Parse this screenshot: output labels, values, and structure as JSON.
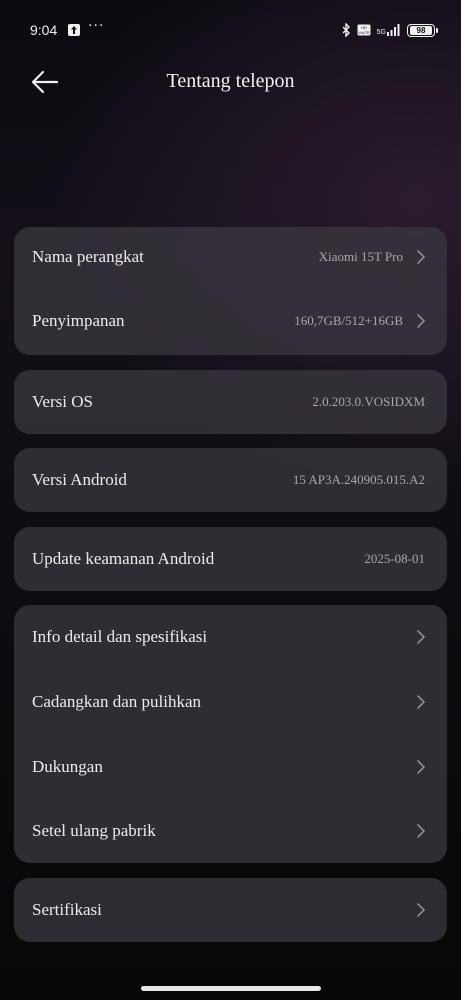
{
  "status_bar": {
    "time": "9:04",
    "overflow": "···",
    "network": "5G",
    "battery": "98"
  },
  "header": {
    "title": "Tentang telepon"
  },
  "cards": {
    "device": [
      {
        "label": "Nama perangkat",
        "value": "Xiaomi 15T Pro"
      },
      {
        "label": "Penyimpanan",
        "value": "160,7GB/512+16GB"
      }
    ],
    "os": {
      "label": "Versi OS",
      "value": "2.0.203.0.VOSIDXM"
    },
    "android": {
      "label": "Versi Android",
      "value": "15 AP3A.240905.015.A2"
    },
    "security": {
      "label": "Update keamanan Android",
      "value": "2025-08-01"
    },
    "more": [
      {
        "label": "Info detail dan spesifikasi"
      },
      {
        "label": "Cadangkan dan pulihkan"
      },
      {
        "label": "Dukungan"
      },
      {
        "label": "Setel ulang pabrik"
      }
    ],
    "cert": {
      "label": "Sertifikasi"
    }
  },
  "icons": {
    "back": "arrow-left-icon",
    "chevron": "chevron-right-icon"
  }
}
